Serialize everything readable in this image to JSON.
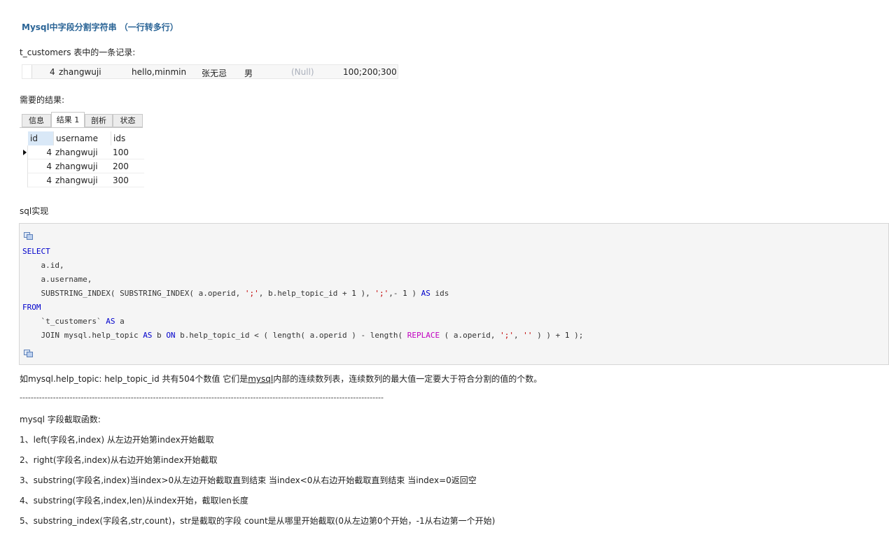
{
  "title": "Mysql中字段分割字符串 （一行转多行）",
  "intro": "t_customers 表中的一条记录:",
  "record": {
    "id": "4",
    "username": "zhangwuji",
    "operid_text": "hello,minmin",
    "name": "张无忌",
    "gender": "男",
    "null_value": "(Null)",
    "operid": "100;200;300"
  },
  "result_label": "需要的结果:",
  "grid": {
    "tabs": [
      "信息",
      "结果 1",
      "剖析",
      "状态"
    ],
    "active_tab": "结果 1",
    "columns": [
      "id",
      "username",
      "ids"
    ],
    "rows": [
      {
        "id": "4",
        "username": "zhangwuji",
        "ids": "100"
      },
      {
        "id": "4",
        "username": "zhangwuji",
        "ids": "200"
      },
      {
        "id": "4",
        "username": "zhangwuji",
        "ids": "300"
      }
    ]
  },
  "sql_label": "sql实现",
  "code": {
    "l1": "SELECT",
    "l2": "    a.id,",
    "l3": "    a.username,",
    "l4a": "    SUBSTRING_INDEX( SUBSTRING_INDEX( a.operid, ",
    "l4b": "';'",
    "l4c": ", b.help_topic_id + ",
    "l4d": "1",
    "l4e": " ), ",
    "l4f": "';'",
    "l4g": ",- ",
    "l4h": "1",
    "l4i": " ) ",
    "l4j": "AS",
    "l4k": " ids",
    "l5": "FROM",
    "l6a": "    `t_customers` ",
    "l6b": "AS",
    "l6c": " a",
    "l7a": "    JOIN mysql.help_topic ",
    "l7b": "AS",
    "l7c": " b ",
    "l7d": "ON",
    "l7e": " b.help_topic_id < ( length( a.operid ) - length( ",
    "l7f": "REPLACE",
    "l7g": " ( a.operid, ",
    "l7h": "';'",
    "l7i": ", ",
    "l7j": "''",
    "l7k": " ) ) + ",
    "l7l": "1",
    "l7m": " );"
  },
  "note_prefix": "如mysql.help_topic:  help_topic_id 共有504个数值 它们是",
  "note_link": "mysql",
  "note_suffix": "内部的连续数列表，连续数列的最大值一定要大于符合分割的值的个数。",
  "separator": "-----------------------------------------------------------------------------------------------------------------------------------",
  "func_title": "mysql 字段截取函数:",
  "funcs": [
    "1、left(字段名,index) 从左边开始第index开始截取",
    "2、right(字段名,index)从右边开始第index开始截取",
    "3、substring(字段名,index)当index>0从左边开始截取直到结束  当index<0从右边开始截取直到结束  当index=0返回空",
    "4、substring(字段名,index,len)从index开始，截取len长度",
    "5、substring_index(字段名,str,count)，str是截取的字段 count是从哪里开始截取(0从左边第0个开始，-1从右边第一个开始)"
  ]
}
